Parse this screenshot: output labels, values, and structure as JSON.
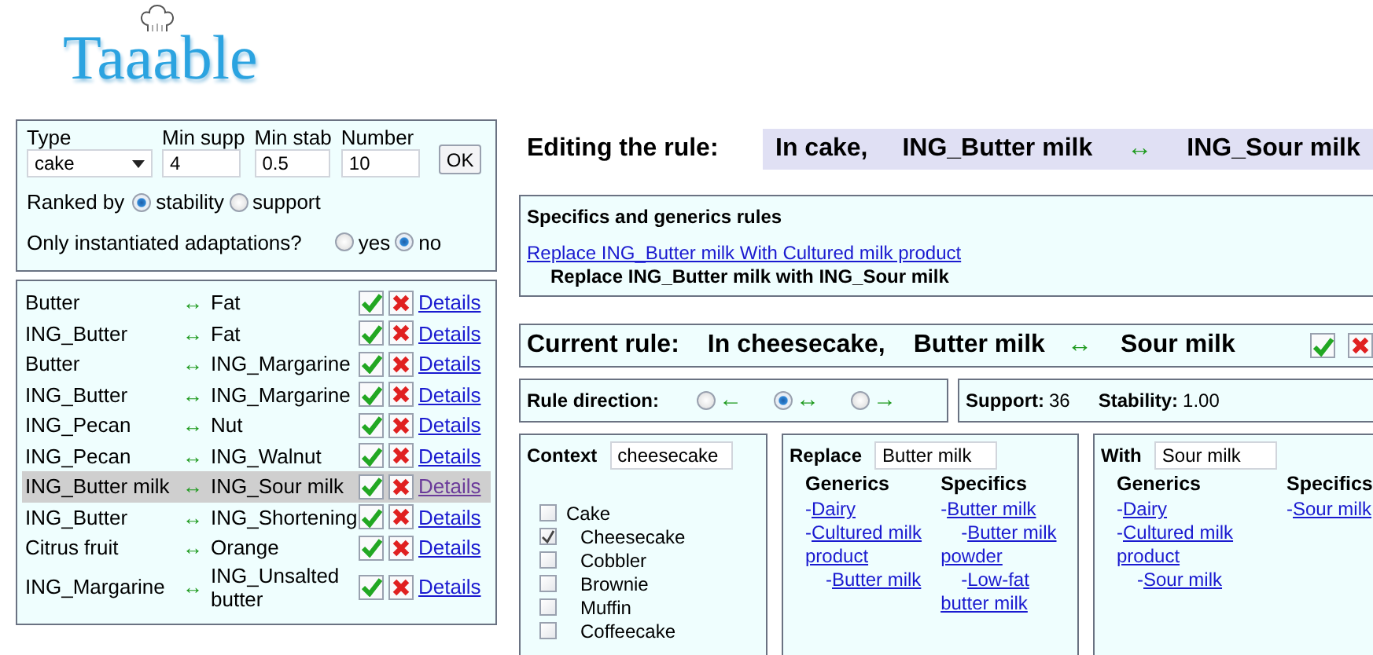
{
  "logo": {
    "text": "Taaable"
  },
  "filter": {
    "type_label": "Type",
    "type_value": "cake",
    "min_supp_label": "Min supp",
    "min_supp_value": "4",
    "min_stab_label": "Min stab",
    "min_stab_value": "0.5",
    "number_label": "Number",
    "number_value": "10",
    "ok_button": "OK",
    "ranked_by": {
      "label": "Ranked by",
      "options": [
        {
          "label": "stability",
          "selected": true
        },
        {
          "label": "support",
          "selected": false
        }
      ]
    },
    "instantiated": {
      "label": "Only instantiated adaptations?",
      "options": [
        {
          "label": "yes",
          "selected": false
        },
        {
          "label": "no",
          "selected": true
        }
      ]
    }
  },
  "rules": [
    {
      "from": "Butter",
      "arrow": "↔",
      "to": "Fat",
      "link": "Details",
      "selected": false
    },
    {
      "from": "ING_Butter",
      "arrow": "↔",
      "to": "Fat",
      "link": "Details",
      "selected": false
    },
    {
      "from": "Butter",
      "arrow": "↔",
      "to": "ING_Margarine",
      "link": "Details",
      "selected": false
    },
    {
      "from": "ING_Butter",
      "arrow": "↔",
      "to": "ING_Margarine",
      "link": "Details",
      "selected": false
    },
    {
      "from": "ING_Pecan",
      "arrow": "↔",
      "to": "Nut",
      "link": "Details",
      "selected": false
    },
    {
      "from": "ING_Pecan",
      "arrow": "↔",
      "to": "ING_Walnut",
      "link": "Details",
      "selected": false
    },
    {
      "from": "ING_Butter milk",
      "arrow": "↔",
      "to": "ING_Sour milk",
      "link": "Details",
      "selected": true
    },
    {
      "from": "ING_Butter",
      "arrow": "↔",
      "to": "ING_Shortening",
      "link": "Details",
      "selected": false
    },
    {
      "from": "Citrus fruit",
      "arrow": "↔",
      "to": "Orange",
      "link": "Details",
      "selected": false
    },
    {
      "from": "ING_Margarine",
      "arrow": "↔",
      "to": "ING_Unsalted butter",
      "link": "Details",
      "selected": false
    }
  ],
  "editing": {
    "label": "Editing the rule:",
    "context": "In cake,",
    "from": "ING_Butter milk",
    "arrow": "↔",
    "to": "ING_Sour milk"
  },
  "specifics": {
    "title": "Specifics and generics rules",
    "items": [
      {
        "text": "Replace ING_Butter milk With Cultured milk product",
        "kind": "link"
      },
      {
        "text": "Replace ING_Butter milk with ING_Sour milk",
        "kind": "current"
      }
    ]
  },
  "current_rule": {
    "label": "Current rule:",
    "context": "In cheesecake,",
    "from": "Butter milk",
    "arrow": "↔",
    "to": "Sour milk"
  },
  "direction": {
    "label": "Rule direction:",
    "options": [
      {
        "arrow": "←",
        "selected": false
      },
      {
        "arrow": "↔",
        "selected": true
      },
      {
        "arrow": "→",
        "selected": false
      }
    ]
  },
  "stats": {
    "support_label": "Support:",
    "support": "36",
    "stability_label": "Stability:",
    "stability": "1.00"
  },
  "context": {
    "label": "Context",
    "value": "cheesecake",
    "tree": [
      {
        "label": "Cake",
        "checked": false,
        "children": [
          {
            "label": "Cheesecake",
            "checked": true
          },
          {
            "label": "Cobbler",
            "checked": false
          },
          {
            "label": "Brownie",
            "checked": false
          },
          {
            "label": "Muffin",
            "checked": false
          },
          {
            "label": "Coffeecake",
            "checked": false
          }
        ]
      }
    ]
  },
  "replace": {
    "label": "Replace",
    "value": "Butter milk",
    "columns": [
      {
        "title": "Generics",
        "items": [
          {
            "marker": "-",
            "label": "Dairy"
          },
          {
            "marker": "-",
            "label": "Cultured milk product",
            "children": [
              {
                "marker": "-",
                "label": "Butter milk"
              }
            ]
          }
        ]
      },
      {
        "title": "Specifics",
        "items": [
          {
            "marker": "-",
            "label": "Butter milk",
            "children": [
              {
                "marker": "-",
                "label": "Butter milk powder"
              },
              {
                "marker": "-",
                "label": "Low-fat butter milk"
              }
            ]
          }
        ]
      }
    ]
  },
  "with": {
    "label": "With",
    "value": "Sour milk",
    "columns": [
      {
        "title": "Generics",
        "items": [
          {
            "marker": "-",
            "label": "Dairy"
          },
          {
            "marker": "-",
            "label": "Cultured milk product",
            "children": [
              {
                "marker": "-",
                "label": "Sour milk"
              }
            ]
          }
        ]
      },
      {
        "title": "Specifics",
        "items": [
          {
            "marker": "-",
            "label": "Sour milk"
          }
        ]
      }
    ]
  }
}
